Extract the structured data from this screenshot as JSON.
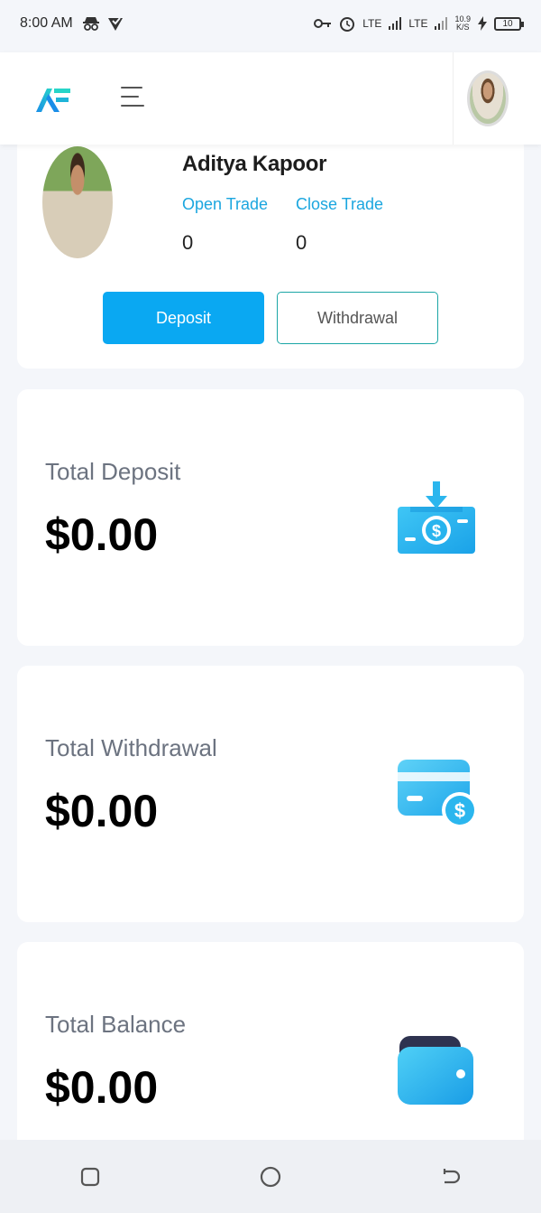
{
  "status_bar": {
    "time": "8:00 AM",
    "network": "LTE",
    "speed": "10.9",
    "speed_unit": "K/S",
    "battery": "10"
  },
  "header": {
    "logo_icon": "app-logo-icon",
    "menu_icon": "hamburger-menu-icon",
    "avatar_icon": "user-avatar"
  },
  "profile": {
    "name": "Aditya Kapoor",
    "open_trade_label": "Open Trade",
    "close_trade_label": "Close Trade",
    "open_trade_value": "0",
    "close_trade_value": "0",
    "deposit_button": "Deposit",
    "withdrawal_button": "Withdrawal"
  },
  "summary": [
    {
      "label": "Total Deposit",
      "value": "$0.00",
      "icon": "deposit-money-icon"
    },
    {
      "label": "Total Withdrawal",
      "value": "$0.00",
      "icon": "credit-card-dollar-icon"
    },
    {
      "label": "Total Balance",
      "value": "$0.00",
      "icon": "wallet-icon"
    }
  ],
  "colors": {
    "accent": "#0aa8f2",
    "link": "#1ba6df",
    "background": "#f4f6fa"
  }
}
